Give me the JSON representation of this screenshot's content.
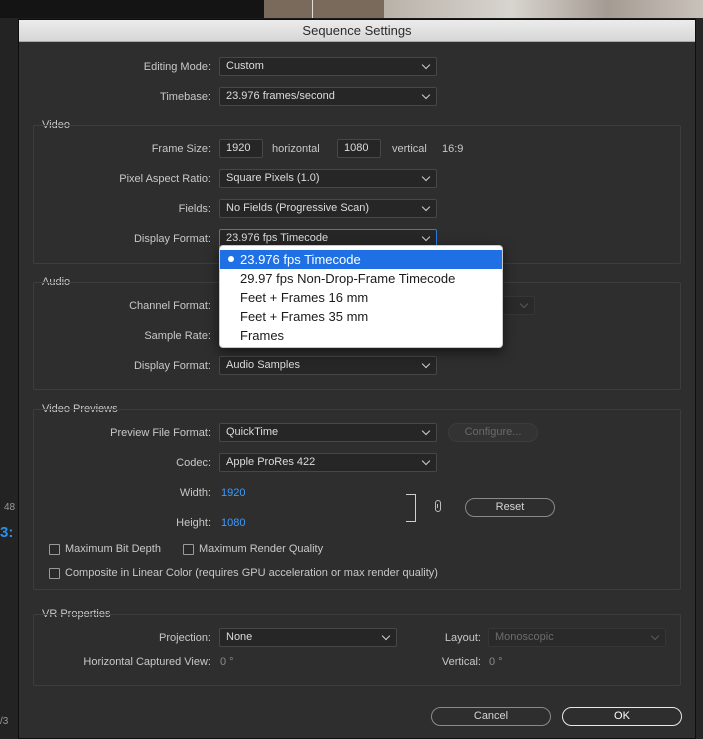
{
  "app": {
    "bg_left_number": "48",
    "bg_left_timecode": "3:",
    "bg_left_page": "/3"
  },
  "dialog": {
    "title": "Sequence Settings",
    "editing_mode": {
      "label": "Editing Mode:",
      "value": "Custom"
    },
    "timebase": {
      "label": "Timebase:",
      "value": "23.976  frames/second"
    },
    "video": {
      "title": "Video",
      "frame_size": {
        "label": "Frame Size:",
        "horizontal_value": "1920",
        "horizontal_label": "horizontal",
        "vertical_value": "1080",
        "vertical_label": "vertical",
        "aspect": "16:9"
      },
      "pixel_aspect": {
        "label": "Pixel Aspect Ratio:",
        "value": "Square Pixels (1.0)"
      },
      "fields": {
        "label": "Fields:",
        "value": "No Fields (Progressive Scan)"
      },
      "display_format": {
        "label": "Display Format:",
        "value": "23.976 fps Timecode"
      }
    },
    "audio": {
      "title": "Audio",
      "channel_format": {
        "label": "Channel Format:"
      },
      "sample_rate": {
        "label": "Sample Rate:"
      },
      "display_format": {
        "label": "Display Format:",
        "value": "Audio Samples"
      }
    },
    "previews": {
      "title": "Video Previews",
      "file_format": {
        "label": "Preview File Format:",
        "value": "QuickTime"
      },
      "configure_label": "Configure...",
      "codec": {
        "label": "Codec:",
        "value": "Apple ProRes 422"
      },
      "width": {
        "label": "Width:",
        "value": "1920"
      },
      "height": {
        "label": "Height:",
        "value": "1080"
      },
      "reset_label": "Reset",
      "max_bit_depth": "Maximum Bit Depth",
      "max_render_quality": "Maximum Render Quality",
      "linear_color": "Composite in Linear Color (requires GPU acceleration or max render quality)"
    },
    "vr": {
      "title": "VR Properties",
      "projection": {
        "label": "Projection:",
        "value": "None"
      },
      "layout": {
        "label": "Layout:",
        "value": "Monoscopic"
      },
      "horizontal_view": {
        "label": "Horizontal Captured View:",
        "value": "0 °"
      },
      "vertical": {
        "label": "Vertical:",
        "value": "0 °"
      }
    },
    "cancel_label": "Cancel",
    "ok_label": "OK"
  },
  "dropdown": {
    "options": [
      {
        "label": "23.976 fps Timecode",
        "selected": true
      },
      {
        "label": "29.97 fps Non-Drop-Frame Timecode",
        "selected": false
      },
      {
        "label": "Feet + Frames 16 mm",
        "selected": false
      },
      {
        "label": "Feet + Frames 35 mm",
        "selected": false
      },
      {
        "label": "Frames",
        "selected": false
      }
    ]
  },
  "colors": {
    "accent": "#1f6fe5",
    "value_blue": "#3b9cff",
    "panel": "#2e2e2e"
  }
}
